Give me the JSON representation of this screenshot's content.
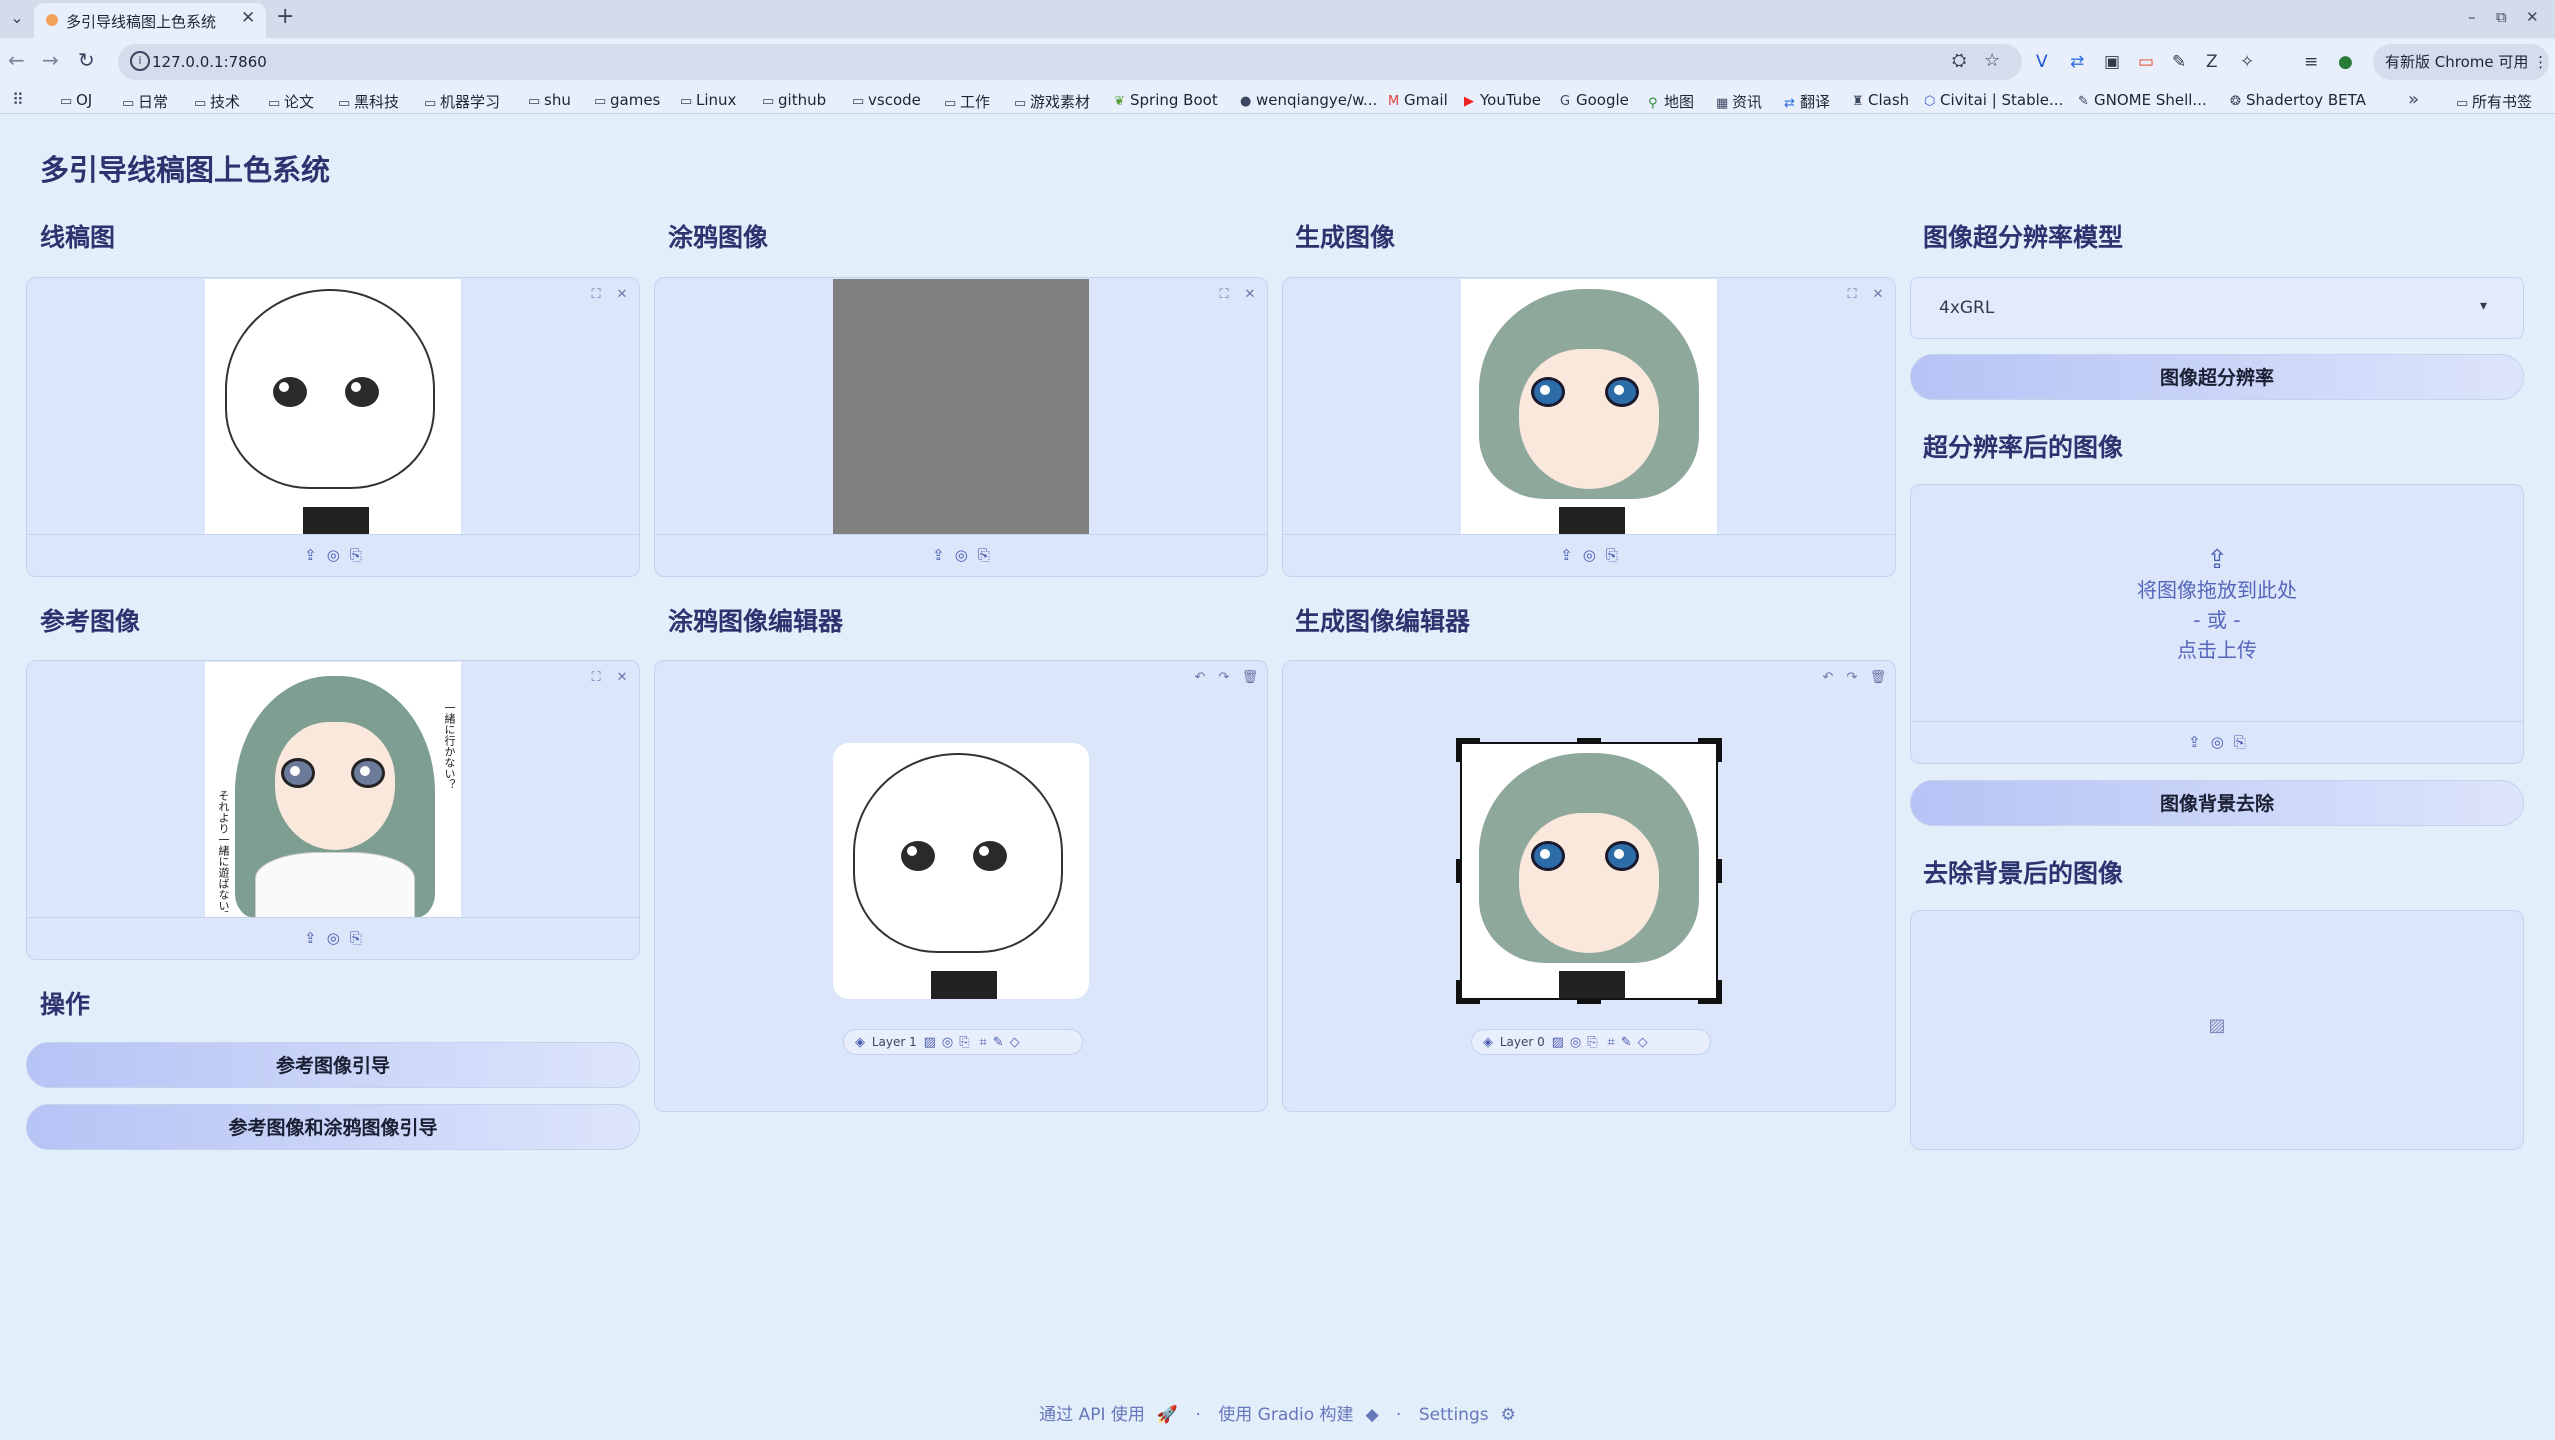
{
  "browser": {
    "tab_title": "多引导线稿图上色系统",
    "url": "127.0.0.1:7860",
    "update_label": "有新版 Chrome 可用",
    "bookmarks": [
      "OJ",
      "日常",
      "技术",
      "论文",
      "黑科技",
      "机器学习",
      "shu",
      "games",
      "Linux",
      "github",
      "vscode",
      "工作",
      "游戏素材",
      "Spring Boot",
      "wenqiangye/w...",
      "Gmail",
      "YouTube",
      "Google",
      "地图",
      "资讯",
      "翻译",
      "Clash",
      "Civitai | Stable...",
      "GNOME Shell...",
      "Shadertoy BETA"
    ],
    "all_bookmarks": "所有书签"
  },
  "app": {
    "title": "多引导线稿图上色系统",
    "sections": {
      "lineart": "线稿图",
      "scribble": "涂鸦图像",
      "generated": "生成图像",
      "reference": "参考图像",
      "scribble_editor": "涂鸦图像编辑器",
      "generated_editor": "生成图像编辑器",
      "operations": "操作",
      "sr_model": "图像超分辨率模型",
      "sr_result": "超分辨率后的图像",
      "bg_removed": "去除背景后的图像"
    },
    "buttons": {
      "ref_guide": "参考图像引导",
      "ref_scribble_guide": "参考图像和涂鸦图像引导",
      "super_res": "图像超分辨率",
      "remove_bg": "图像背景去除"
    },
    "sr_model_value": "4xGRL",
    "upload": {
      "drop": "将图像拖放到此处",
      "or": "- 或 -",
      "click": "点击上传"
    },
    "layers": {
      "scribble": "Layer 1",
      "generated": "Layer 0"
    },
    "ref_text_1": "一緒に行かない？",
    "ref_text_2": "それより一緒に遊ばない？"
  },
  "footer": {
    "api": "通过 API 使用",
    "gradio": "使用 Gradio 构建",
    "settings": "Settings"
  },
  "colors": {
    "page_bg": "#e3eefb",
    "accent": "#2c3470",
    "panel_bg": "#dbe6fb"
  }
}
